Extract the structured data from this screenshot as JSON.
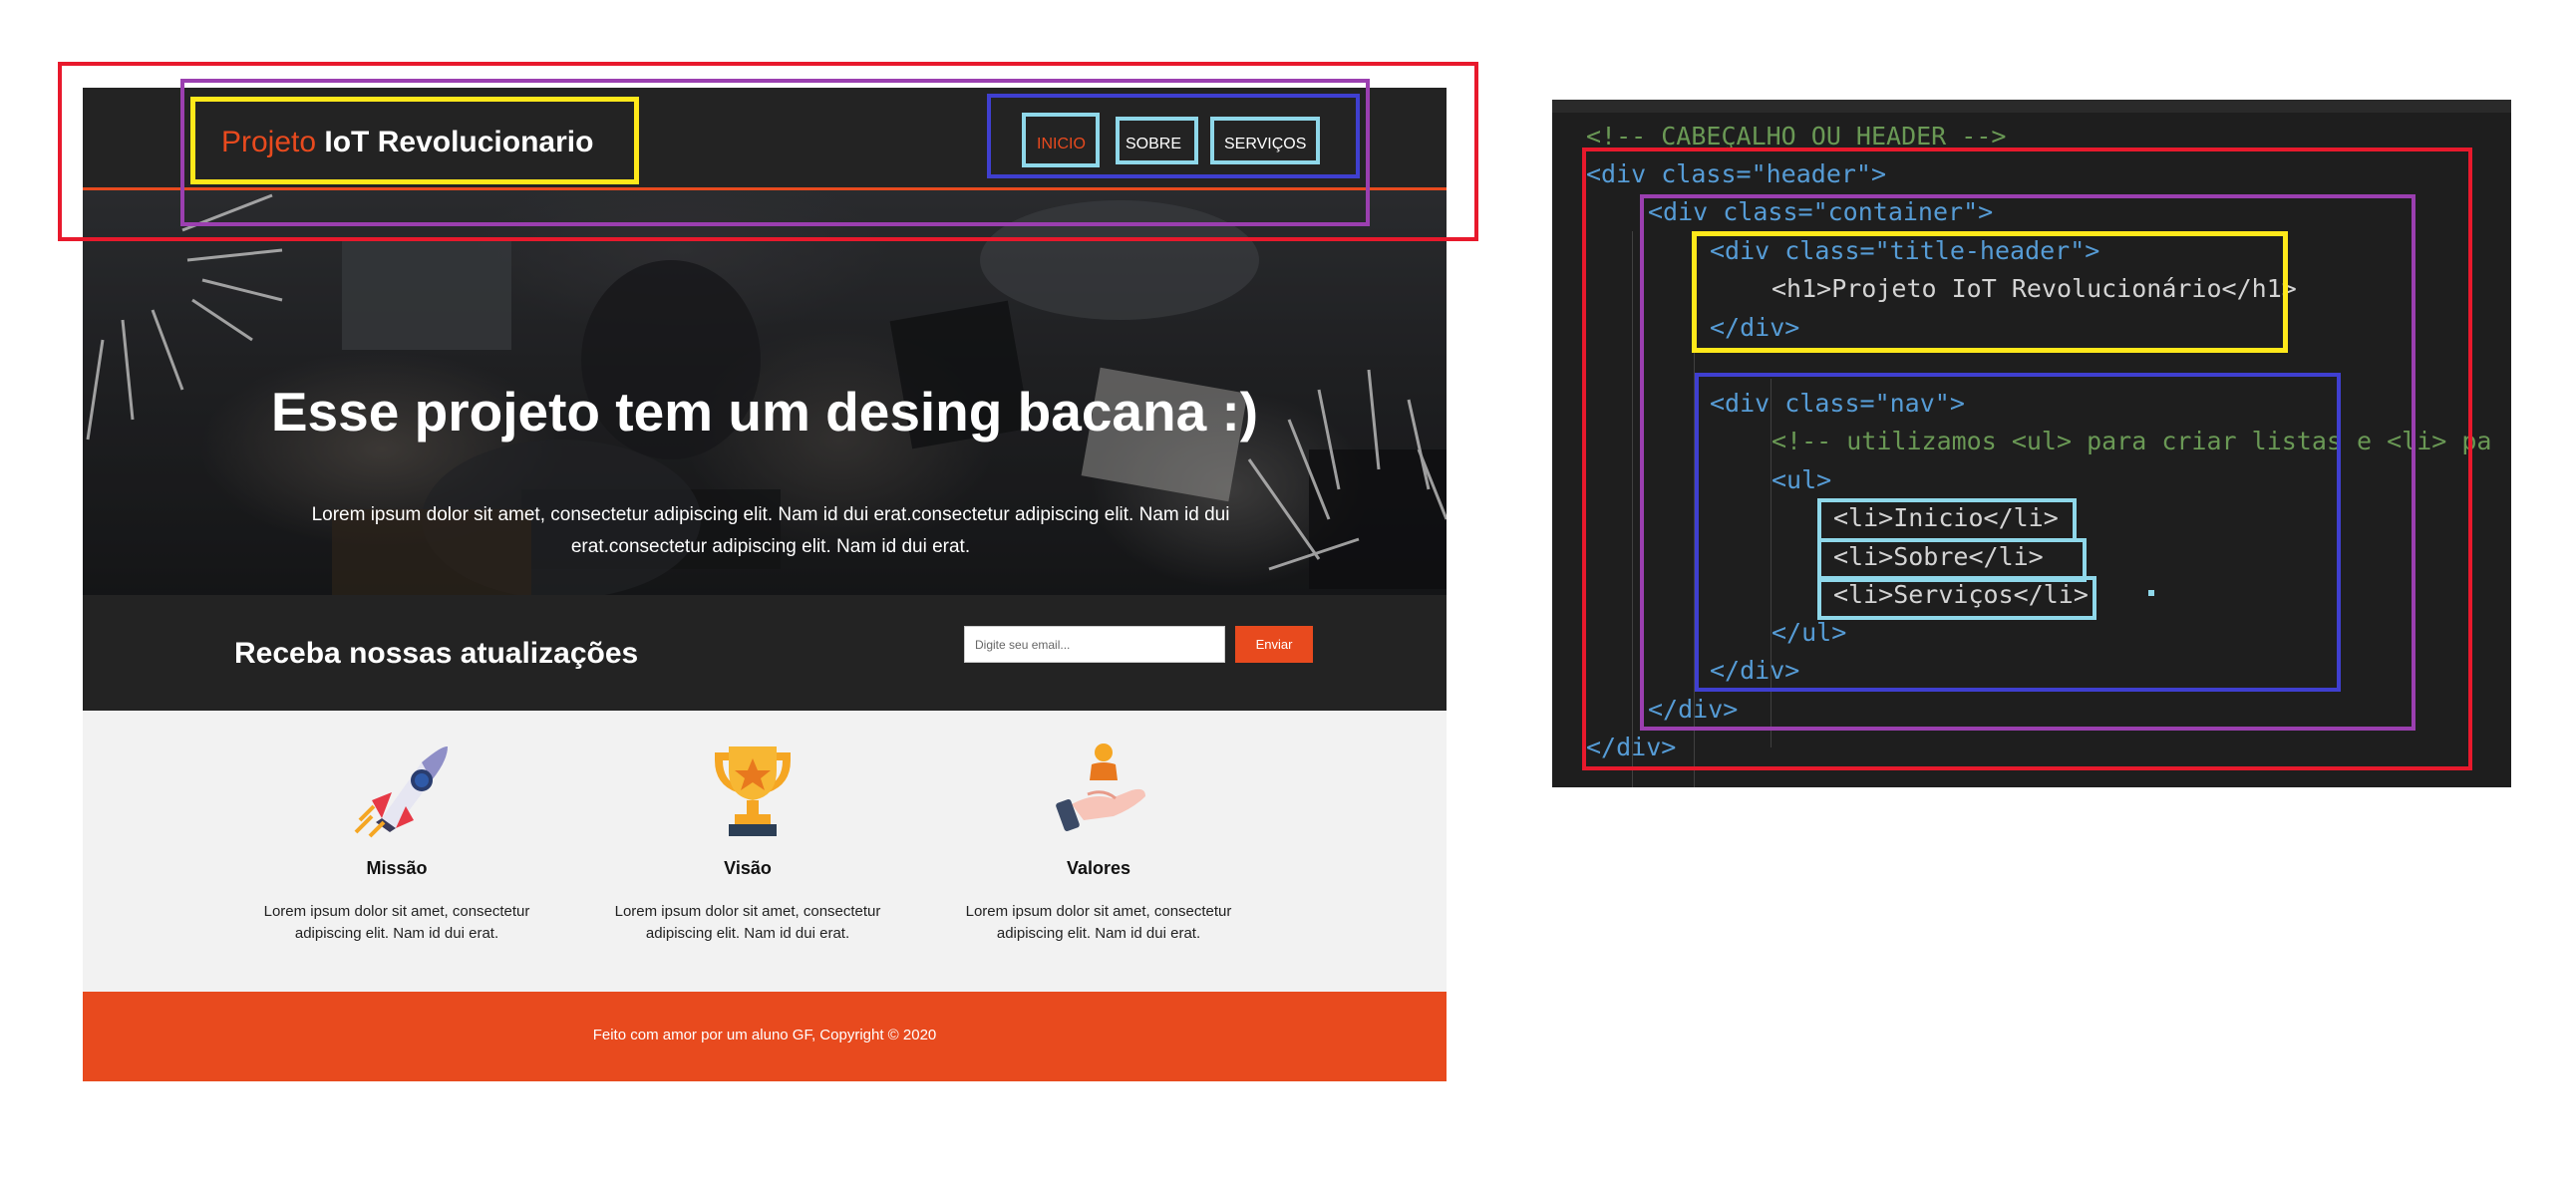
{
  "site": {
    "brand_accent": "Projeto",
    "brand_rest": " IoT Revolucionario",
    "nav": [
      "INICIO",
      "SOBRE",
      "SERVIÇOS"
    ],
    "hero_title": "Esse projeto tem um desing bacana :)",
    "hero_text": "Lorem ipsum dolor sit amet, consectetur adipiscing elit. Nam id dui erat.consectetur adipiscing elit. Nam id dui erat.consectetur adipiscing elit. Nam id dui erat.",
    "newsletter_title": "Receba nossas atualizações",
    "email_placeholder": "Digite seu email...",
    "send_label": "Enviar",
    "features": [
      {
        "icon": "rocket-icon",
        "title": "Missão",
        "text": "Lorem ipsum dolor sit amet, consectetur adipiscing elit. Nam id dui erat."
      },
      {
        "icon": "trophy-icon",
        "title": "Visão",
        "text": "Lorem ipsum dolor sit amet, consectetur adipiscing elit. Nam id dui erat."
      },
      {
        "icon": "hand-person-icon",
        "title": "Valores",
        "text": "Lorem ipsum dolor sit amet, consectetur adipiscing elit. Nam id dui erat."
      }
    ],
    "footer": "Feito com amor por um aluno GF, Copyright © 2020"
  },
  "code": {
    "comment_header": "<!-- CABEÇALHO OU HEADER -->",
    "div_header_open": "<div class=\"header\">",
    "div_container_open": "<div class=\"container\">",
    "div_title_open": "<div class=\"title-header\">",
    "h1": "<h1>Projeto IoT Revolucionário</h1>",
    "div_close": "</div>",
    "div_nav_open": "<div class=\"nav\">",
    "comment_ul": "<!-- utilizamos <ul> para criar listas e <li> pa",
    "ul_open": "<ul>",
    "li_1": "<li>Inicio</li>",
    "li_2": "<li>Sobre</li>",
    "li_3": "<li>Serviços</li>",
    "ul_close": "</ul>"
  },
  "colors": {
    "accent": "#e84a1e",
    "dark": "#232323",
    "box_red": "#e8192c",
    "box_purple": "#9b3fb0",
    "box_yellow": "#ffe81a",
    "box_blue": "#3f3fd0",
    "box_cyan": "#8fd8ea",
    "code_tag": "#569cd6",
    "code_attr": "#9cdcfe",
    "code_string": "#ce9178",
    "code_comment": "#6a9955",
    "code_text": "#d4d4d4"
  }
}
